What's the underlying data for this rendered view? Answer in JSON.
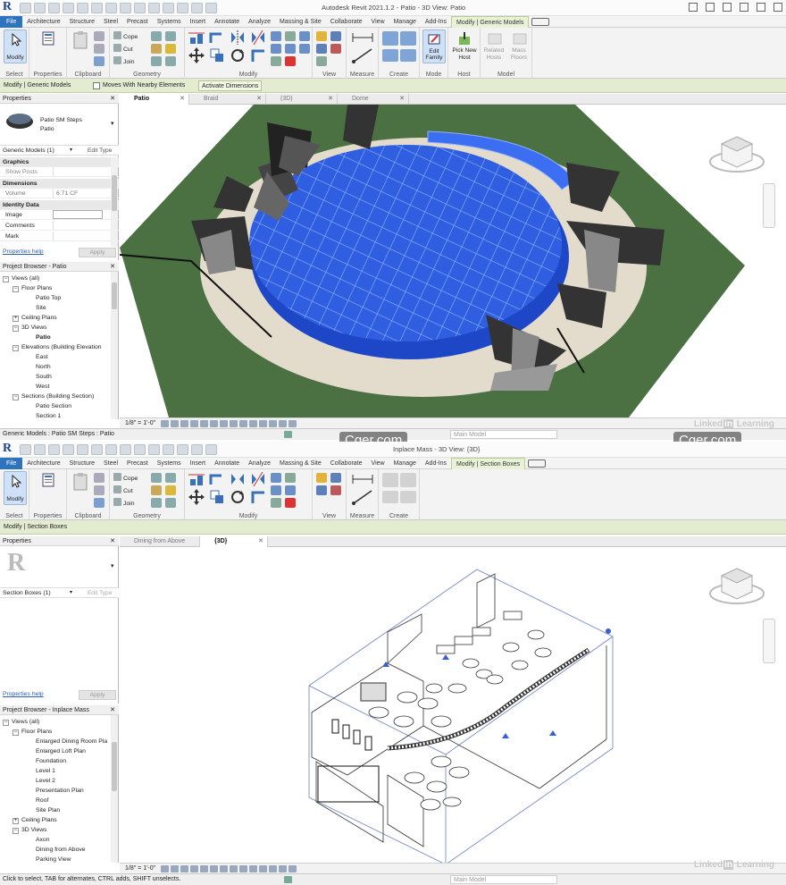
{
  "top": {
    "title": "Autodesk Revit 2021.1.2 - Patio - 3D View: Patio",
    "tabs": [
      "File",
      "Architecture",
      "Structure",
      "Steel",
      "Precast",
      "Systems",
      "Insert",
      "Annotate",
      "Analyze",
      "Massing & Site",
      "Collaborate",
      "View",
      "Manage",
      "Add-Ins",
      "Modify | Generic Models"
    ],
    "ribbon": {
      "select_label": "Select",
      "properties_label": "Properties",
      "clipboard_label": "Clipboard",
      "geometry_label": "Geometry",
      "modify_label": "Modify",
      "view_label": "View",
      "measure_label": "Measure",
      "create_label": "Create",
      "mode_label": "Mode",
      "host_label": "Host",
      "model_label": "Model",
      "modify_btn": "Modify",
      "cope": "Cope",
      "cut": "Cut",
      "join": "Join",
      "edit_family": "Edit Family",
      "pick_new_host": "Pick New Host",
      "related_hosts": "Related Hosts",
      "mass_floors": "Mass Floors"
    },
    "ctx": {
      "label": "Modify | Generic Models",
      "moves_with": "Moves With Nearby Elements",
      "activate": "Activate Dimensions"
    },
    "properties": {
      "title": "Properties",
      "family": "Patio SM Steps",
      "type": "Patio",
      "selector": "Generic Models (1)",
      "edit_type": "Edit Type",
      "graphics": "Graphics",
      "show_posts": "Show Posts",
      "dimensions": "Dimensions",
      "volume": "Volume",
      "volume_val": "6.71 CF",
      "identity": "Identity Data",
      "image": "Image",
      "comments": "Comments",
      "mark": "Mark",
      "help": "Properties help",
      "apply": "Apply"
    },
    "browser": {
      "title": "Project Browser - Patio",
      "items": [
        "Views (all)",
        "Floor Plans",
        "Patio Top",
        "Site",
        "Ceiling Plans",
        "3D Views",
        "Patio",
        "Elevations (Building Elevation",
        "East",
        "North",
        "South",
        "West",
        "Sections (Building Section)",
        "Patio Section",
        "Section 1"
      ]
    },
    "view_tabs": [
      "Patio",
      "Braid",
      "(3D)",
      "Dome"
    ],
    "scale": "1/8\" = 1'-0\"",
    "status": "Generic Models : Patio SM Steps : Patio",
    "model": "Main Model",
    "watermark": "Cger.com",
    "watermark2": "Cger.com",
    "linkedin_a": "Linked",
    "linkedin_b": "in",
    "linkedin_c": " Learning"
  },
  "bottom": {
    "title": "Inplace Mass - 3D View: {3D}",
    "tabs": [
      "File",
      "Architecture",
      "Structure",
      "Steel",
      "Precast",
      "Systems",
      "Insert",
      "Annotate",
      "Analyze",
      "Massing & Site",
      "Collaborate",
      "View",
      "Manage",
      "Add-Ins",
      "Modify | Section Boxes"
    ],
    "ctx_label": "Modify | Section Boxes",
    "properties": {
      "title": "Properties",
      "selector": "Section Boxes (1)",
      "edit_type": "Edit Type",
      "help": "Properties help",
      "apply": "Apply"
    },
    "browser": {
      "title": "Project Browser - Inplace Mass",
      "items": [
        "Views (all)",
        "Floor Plans",
        "Enlarged Dining Room Pla",
        "Enlarged Loft Plan",
        "Foundation",
        "Level 1",
        "Level 2",
        "Presentation Plan",
        "Roof",
        "Site Plan",
        "Ceiling Plans",
        "3D Views",
        "Axon",
        "Dining from Above",
        "Parking View"
      ]
    },
    "view_tabs": [
      "Dining from Above",
      "{3D}"
    ],
    "scale": "1/8\" = 1'-0\"",
    "status": "Click to select, TAB for alternates, CTRL adds, SHIFT unselects.",
    "model": "Main Model",
    "linkedin_a": "Linked",
    "linkedin_b": "in",
    "linkedin_c": " Learning"
  },
  "colors": {
    "accent": "#2d73bd",
    "context": "#e3ecd1",
    "selection": "#2f5fe0",
    "lawn": "#4b7142",
    "pavement": "#e3dccd"
  }
}
